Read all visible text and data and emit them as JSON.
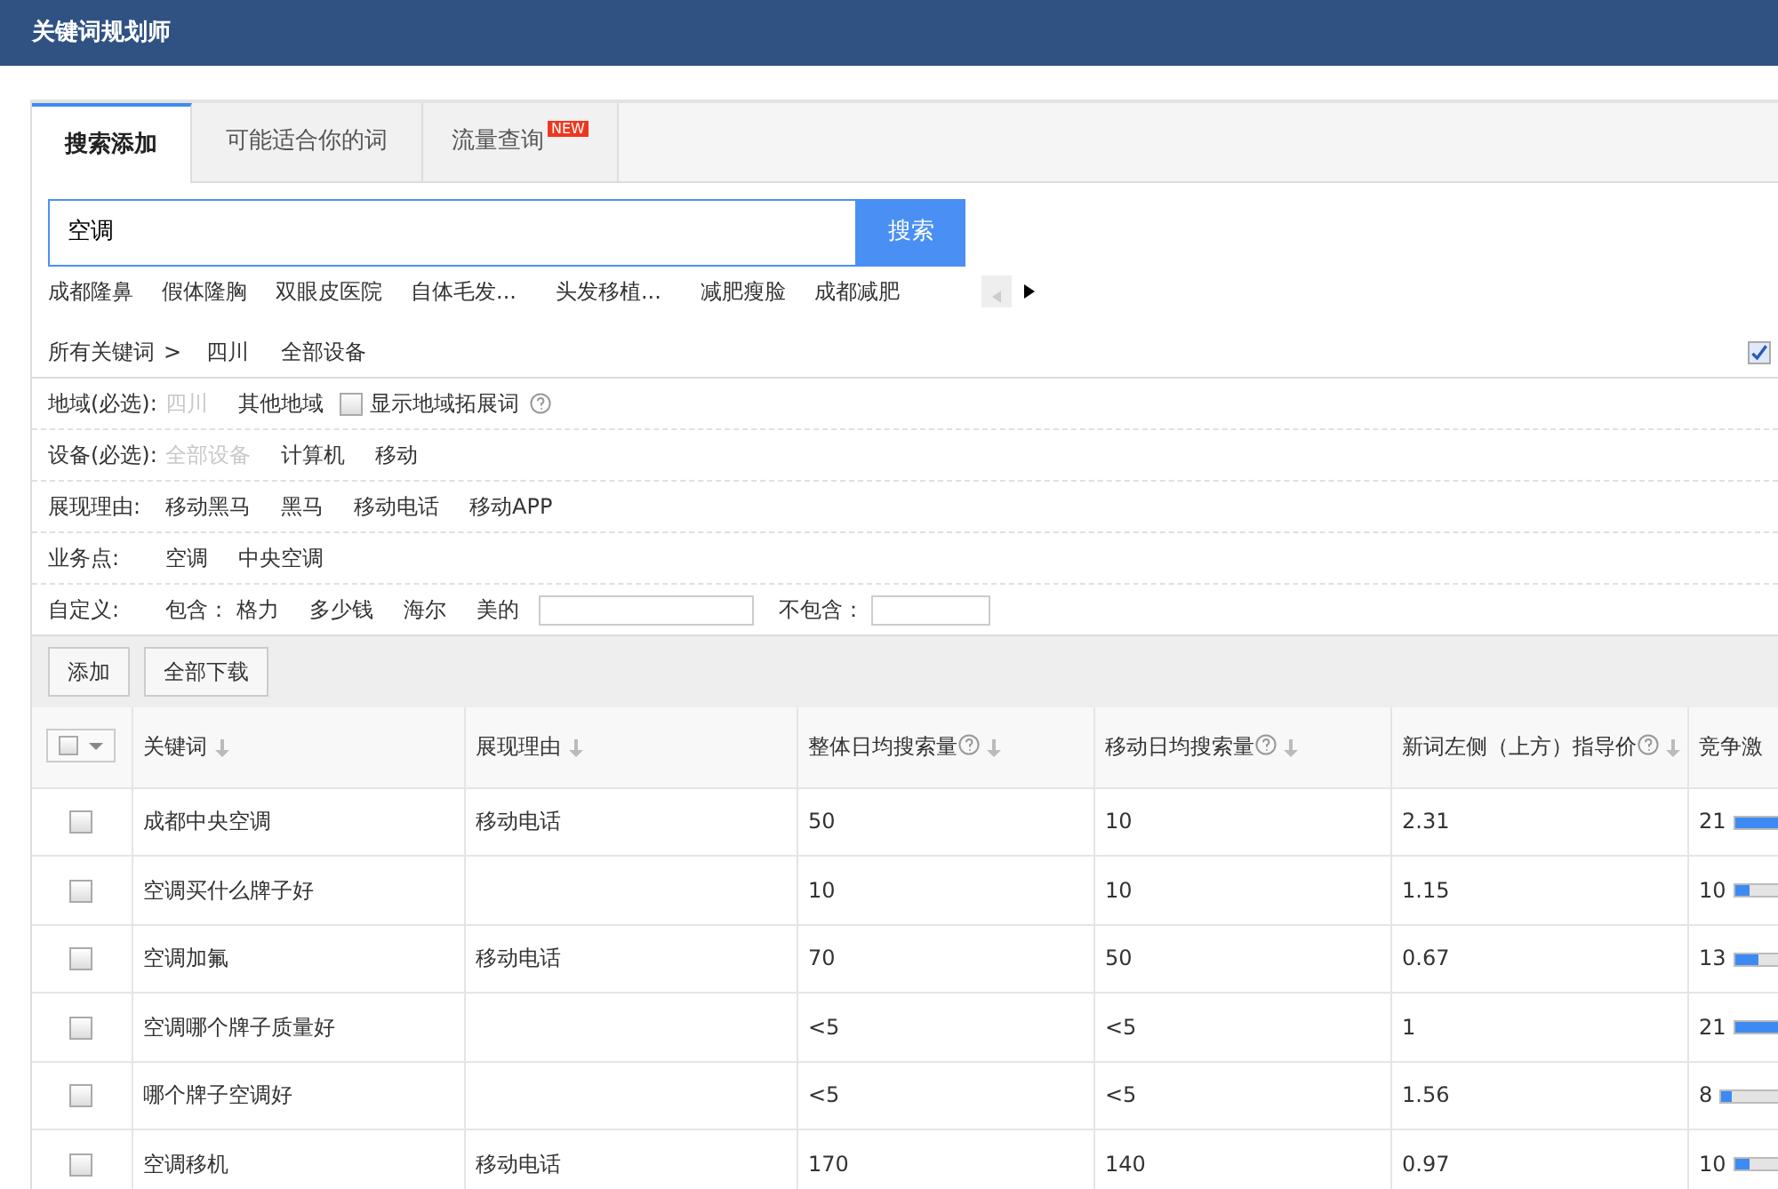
{
  "app_title": "关键词规划师",
  "tabs": [
    {
      "label": "搜索添加",
      "selected": true
    },
    {
      "label": "可能适合你的词",
      "selected": false
    },
    {
      "label": "流量查询",
      "selected": false,
      "badge": "NEW"
    }
  ],
  "search": {
    "value": "空调",
    "button": "搜索"
  },
  "suggestions": [
    "成都隆鼻",
    "假体隆胸",
    "双眼皮医院",
    "自体毛发...",
    "头发移植...",
    "减肥瘦脸",
    "成都减肥"
  ],
  "suggestion_prev_disabled": true,
  "breadcrumb": {
    "root": "所有关键词",
    "separator": ">",
    "items": [
      "四川",
      "全部设备"
    ]
  },
  "corner_checkbox": {
    "checked": true
  },
  "filters": [
    {
      "label": "地域(必选):",
      "options": [
        {
          "text": "四川",
          "disabled": true
        },
        {
          "text": "其他地域",
          "disabled": false
        }
      ],
      "checkbox": {
        "label": "显示地域拓展词",
        "checked": false
      }
    },
    {
      "label": "设备(必选):",
      "options": [
        {
          "text": "全部设备",
          "disabled": true
        },
        {
          "text": "计算机",
          "disabled": false
        },
        {
          "text": "移动",
          "disabled": false
        }
      ]
    },
    {
      "label": "展现理由:",
      "options": [
        {
          "text": "移动黑马",
          "disabled": false
        },
        {
          "text": "黑马",
          "disabled": false
        },
        {
          "text": "移动电话",
          "disabled": false
        },
        {
          "text": "移动APP",
          "disabled": false
        }
      ]
    },
    {
      "label": "业务点:",
      "options": [
        {
          "text": "空调",
          "disabled": false
        },
        {
          "text": "中央空调",
          "disabled": false
        }
      ]
    },
    {
      "label": "自定义:",
      "include_label": "包含：",
      "options": [
        {
          "text": "格力",
          "disabled": false
        },
        {
          "text": "多少钱",
          "disabled": false
        },
        {
          "text": "海尔",
          "disabled": false
        },
        {
          "text": "美的",
          "disabled": false
        }
      ],
      "exclude_label": "不包含："
    }
  ],
  "toolbar": [
    "添加",
    "全部下载"
  ],
  "table": {
    "columns": [
      {
        "label": "关键词",
        "help": false
      },
      {
        "label": "展现理由",
        "help": false
      },
      {
        "label": "整体日均搜索量",
        "help": true
      },
      {
        "label": "移动日均搜索量",
        "help": true
      },
      {
        "label": "新词左侧（上方）指导价",
        "help": true
      },
      {
        "label": "竞争激",
        "help": false
      }
    ],
    "rows": [
      {
        "checked": false,
        "keyword": "成都中央空调",
        "reason": "移动电话",
        "overall": "50",
        "mobile": "10",
        "price": "2.31",
        "competition": "21",
        "level": 0.42
      },
      {
        "checked": false,
        "keyword": "空调买什么牌子好",
        "overall": "10",
        "mobile": "10",
        "price": "1.15",
        "competition": "10",
        "level": 0.15
      },
      {
        "checked": false,
        "keyword": "空调加氟",
        "reason": "移动电话",
        "overall": "70",
        "mobile": "50",
        "price": "0.67",
        "competition": "13",
        "level": 0.22
      },
      {
        "checked": false,
        "keyword": "空调哪个牌子质量好",
        "overall": "<5",
        "mobile": "<5",
        "price": "1",
        "competition": "21",
        "level": 0.42
      },
      {
        "checked": false,
        "keyword": "哪个牌子空调好",
        "overall": "<5",
        "mobile": "<5",
        "price": "1.56",
        "competition": "8",
        "level": 0.1
      },
      {
        "checked": false,
        "keyword": "空调移机",
        "reason": "移动电话",
        "overall": "170",
        "mobile": "140",
        "price": "0.97",
        "competition": "10",
        "level": 0.15
      }
    ]
  }
}
